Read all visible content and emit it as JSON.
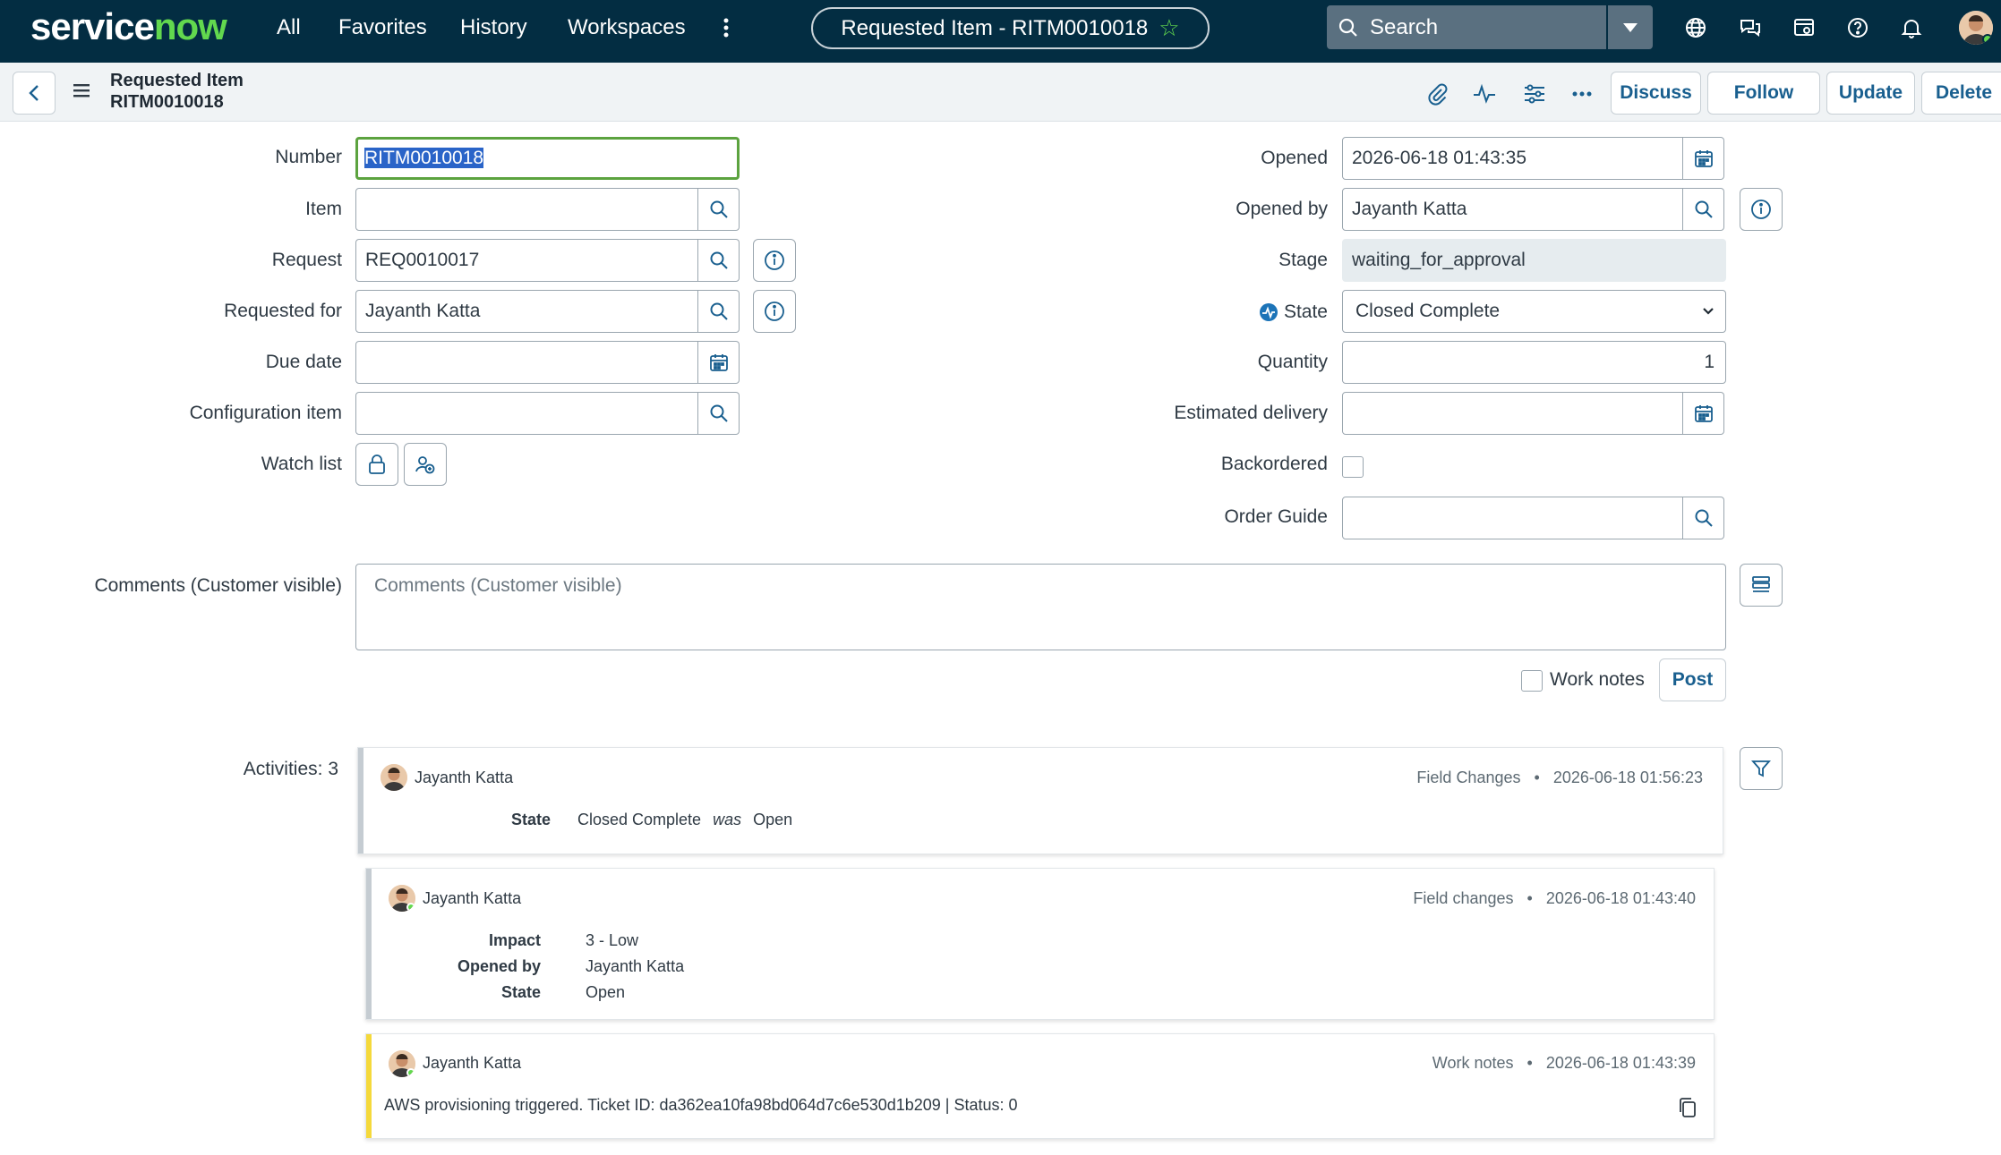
{
  "topbar": {
    "logo": "servicenow",
    "nav": [
      "All",
      "Favorites",
      "History",
      "Workspaces"
    ],
    "record_pill": "Requested Item - RITM0010018",
    "search_placeholder": "Search"
  },
  "subbar": {
    "title_line1": "Requested Item",
    "title_line2": "RITM0010018",
    "buttons": {
      "discuss": "Discuss",
      "follow": "Follow",
      "update": "Update",
      "delete": "Delete"
    }
  },
  "form": {
    "left": {
      "number": {
        "label": "Number",
        "value": "RITM0010018"
      },
      "item": {
        "label": "Item",
        "value": ""
      },
      "request": {
        "label": "Request",
        "value": "REQ0010017"
      },
      "requested_for": {
        "label": "Requested for",
        "value": "Jayanth Katta"
      },
      "due_date": {
        "label": "Due date",
        "value": ""
      },
      "configuration_item": {
        "label": "Configuration item",
        "value": ""
      },
      "watch_list": {
        "label": "Watch list"
      }
    },
    "right": {
      "opened": {
        "label": "Opened",
        "value": "2026-06-18 01:43:35"
      },
      "opened_by": {
        "label": "Opened by",
        "value": "Jayanth Katta"
      },
      "stage": {
        "label": "Stage",
        "value": "waiting_for_approval"
      },
      "state": {
        "label": "State",
        "value": "Closed Complete"
      },
      "quantity": {
        "label": "Quantity",
        "value": "1"
      },
      "estimated_delivery": {
        "label": "Estimated delivery",
        "value": ""
      },
      "backordered": {
        "label": "Backordered",
        "checked": false
      },
      "order_guide": {
        "label": "Order Guide",
        "value": ""
      }
    },
    "comments": {
      "label": "Comments (Customer visible)",
      "placeholder": "Comments (Customer visible)"
    },
    "work_notes_label": "Work notes",
    "post_label": "Post"
  },
  "activities": {
    "label": "Activities: 3",
    "entries": [
      {
        "author": "Jayanth Katta",
        "type": "Field Changes",
        "timestamp": "2026-06-18 01:56:23",
        "changes": [
          {
            "field": "State",
            "new": "Closed Complete",
            "was_word": "was",
            "old": "Open"
          }
        ]
      },
      {
        "author": "Jayanth Katta",
        "type": "Field changes",
        "timestamp": "2026-06-18 01:43:40",
        "changes": [
          {
            "field": "Impact",
            "value": "3 - Low"
          },
          {
            "field": "Opened by",
            "value": "Jayanth Katta"
          },
          {
            "field": "State",
            "value": "Open"
          }
        ]
      },
      {
        "author": "Jayanth Katta",
        "type": "Work notes",
        "timestamp": "2026-06-18 01:43:39",
        "text": "AWS provisioning triggered. Ticket ID: da362ea10fa98bd064d7c6e530d1b209 | Status: 0"
      }
    ]
  },
  "colors": {
    "topbar": "#032d42",
    "accent_green": "#62d84e",
    "button_text": "#195f8f",
    "work_note_bar": "#f5d93b",
    "activity_bar": "#c5ccd2"
  }
}
